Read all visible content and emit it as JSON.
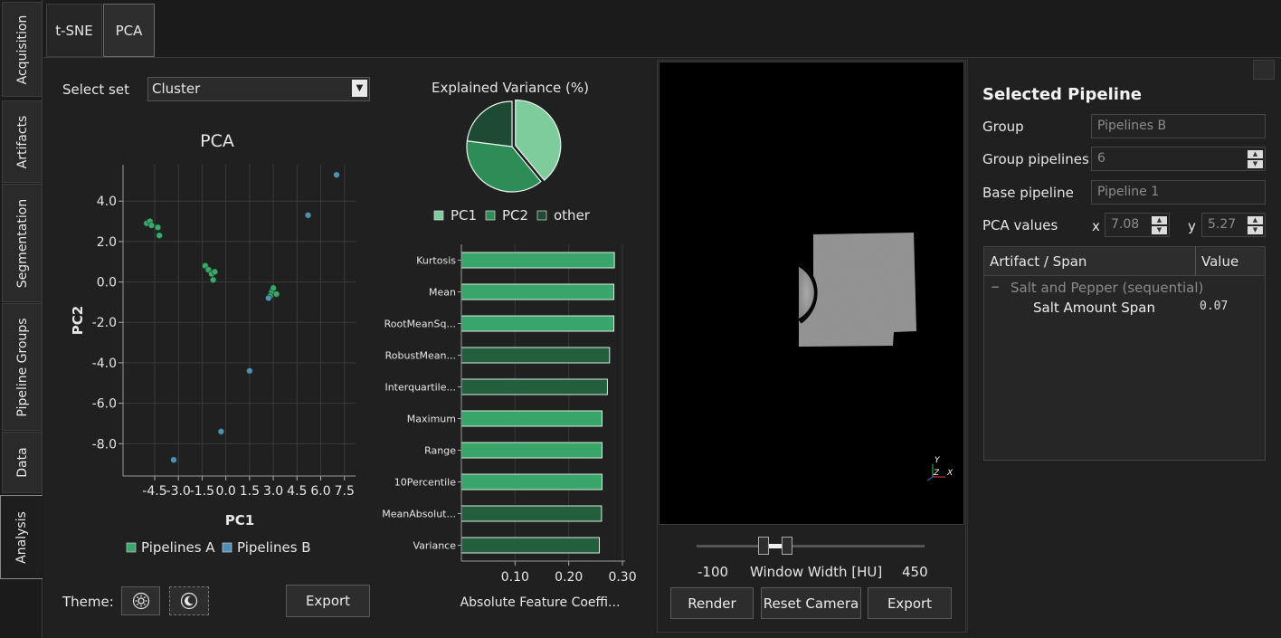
{
  "sidebar": {
    "tabs": [
      {
        "label": "Acquisition",
        "active": false
      },
      {
        "label": "Artifacts",
        "active": false
      },
      {
        "label": "Segmentation",
        "active": false
      },
      {
        "label": "Pipeline Groups",
        "active": false
      },
      {
        "label": "Data",
        "active": false
      },
      {
        "label": "Analysis",
        "active": true
      }
    ]
  },
  "top_tabs": [
    {
      "label": "t-SNE",
      "active": false
    },
    {
      "label": "PCA",
      "active": true
    }
  ],
  "controls": {
    "select_set_label": "Select set",
    "select_set_value": "Cluster",
    "theme_label": "Theme:",
    "theme_light_icon": "sun-icon",
    "theme_dark_icon": "moon-icon",
    "export_label": "Export"
  },
  "colors": {
    "pipelines_a": "#3aa86a",
    "pipelines_b": "#4f90b4",
    "pc1": "#7ecb9c",
    "pc2": "#2e8c57",
    "other": "#1e4a33",
    "bar_light": "#3aa56a",
    "bar_dark": "#245f3d"
  },
  "chart_data": [
    {
      "type": "scatter",
      "title": "PCA",
      "xlabel": "PC1",
      "ylabel": "PC2",
      "xlim": [
        -6.5,
        8.2
      ],
      "ylim": [
        -9.6,
        5.8
      ],
      "x_ticks": [
        "-4.5",
        "-3.0",
        "-1.5",
        "0.0",
        "1.5",
        "3.0",
        "4.5",
        "6.0",
        "7.5"
      ],
      "y_ticks": [
        "4.0",
        "2.0",
        "0.0",
        "-2.0",
        "-4.0",
        "-6.0",
        "-8.0"
      ],
      "legend": [
        "Pipelines A",
        "Pipelines B"
      ],
      "series": [
        {
          "name": "Pipelines A",
          "points": [
            [
              -5.0,
              2.9
            ],
            [
              -4.8,
              3.0
            ],
            [
              -4.7,
              2.8
            ],
            [
              -4.3,
              2.7
            ],
            [
              -4.2,
              2.3
            ],
            [
              -1.3,
              0.8
            ],
            [
              -1.1,
              0.6
            ],
            [
              -0.9,
              0.4
            ],
            [
              -0.8,
              0.1
            ],
            [
              -0.7,
              0.5
            ],
            [
              2.9,
              -0.5
            ],
            [
              3.0,
              -0.3
            ],
            [
              3.2,
              -0.6
            ],
            [
              2.8,
              -0.7
            ]
          ]
        },
        {
          "name": "Pipelines B",
          "points": [
            [
              7.0,
              5.3
            ],
            [
              5.2,
              3.3
            ],
            [
              1.5,
              -4.4
            ],
            [
              -0.3,
              -7.4
            ],
            [
              -3.3,
              -8.8
            ],
            [
              2.7,
              -0.8
            ]
          ]
        }
      ]
    },
    {
      "type": "pie",
      "title": "Explained Variance (%)",
      "labels": [
        "PC1",
        "PC2",
        "other"
      ],
      "values": [
        39,
        38,
        23
      ]
    },
    {
      "type": "bar",
      "orientation": "horizontal",
      "xlabel": "Absolute Feature Coeffi...",
      "x_ticks": [
        "0.10",
        "0.20",
        "0.30"
      ],
      "xlim": [
        0,
        0.305
      ],
      "categories": [
        "Kurtosis",
        "Mean",
        "RootMeanSq...",
        "RobustMean...",
        "Interquartile...",
        "Maximum",
        "Range",
        "10Percentile",
        "MeanAbsolut...",
        "Variance"
      ],
      "values": [
        0.285,
        0.284,
        0.284,
        0.276,
        0.272,
        0.262,
        0.262,
        0.262,
        0.261,
        0.257
      ],
      "shade": [
        "light",
        "light",
        "light",
        "dark",
        "dark",
        "light",
        "light",
        "light",
        "dark",
        "dark"
      ]
    }
  ],
  "viewer": {
    "window_min": "-100",
    "window_label": "Window Width [HU]",
    "window_max": "450",
    "render_label": "Render",
    "reset_label": "Reset Camera",
    "export_label": "Export",
    "axis_labels": {
      "y": "Y",
      "z": "Z",
      "x": "X"
    }
  },
  "selected_pipeline": {
    "title": "Selected Pipeline",
    "group_label": "Group",
    "group_value": "Pipelines B",
    "group_pipelines_label": "Group pipelines",
    "group_pipelines_value": "6",
    "base_pipeline_label": "Base pipeline",
    "base_pipeline_value": "Pipeline 1",
    "pca_values_label": "PCA values",
    "pca_x_label": "x",
    "pca_x_value": "7.08",
    "pca_y_label": "y",
    "pca_y_value": "5.27",
    "table": {
      "col_artifact": "Artifact / Span",
      "col_value": "Value",
      "group_row": "Salt and Pepper (sequential)",
      "collapse_glyph": "−",
      "child_label": "Salt Amount Span",
      "child_value": "0.07"
    }
  }
}
